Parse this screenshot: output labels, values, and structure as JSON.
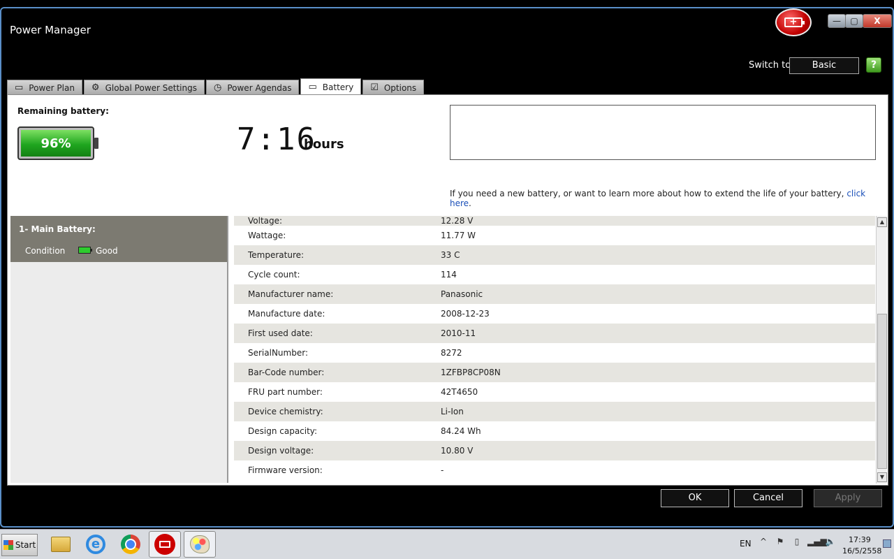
{
  "window": {
    "title": "Power Manager",
    "controls": {
      "minimize": "—",
      "maximize": "▢",
      "close": "X"
    }
  },
  "header": {
    "switch_label": "Switch to:",
    "switch_value": "Basic",
    "help_icon": "?"
  },
  "tabs": [
    {
      "label": "Power Plan",
      "icon": "laptop-icon",
      "glyph": "▭"
    },
    {
      "label": "Global Power Settings",
      "icon": "gear-icon",
      "glyph": "⚙"
    },
    {
      "label": "Power Agendas",
      "icon": "clock-icon",
      "glyph": "◷"
    },
    {
      "label": "Battery",
      "icon": "battery-icon",
      "glyph": "▭",
      "active": true
    },
    {
      "label": "Options",
      "icon": "checkbox-icon",
      "glyph": "☑"
    }
  ],
  "battery_summary": {
    "remaining_label": "Remaining battery:",
    "percent": "96%",
    "time": "7:16",
    "time_unit": "hours",
    "info_text": "If you need a new battery, or want to learn more about how to extend the life of your battery,",
    "info_link": "click here",
    "info_suffix": "."
  },
  "batteries": [
    {
      "name": "1- Main Battery:",
      "condition_label": "Condition",
      "condition_value": "Good",
      "condition_color": "#2ecc2e"
    }
  ],
  "details": [
    {
      "key": "Voltage:",
      "value": "12.28 V"
    },
    {
      "key": "Wattage:",
      "value": "11.77 W"
    },
    {
      "key": "Temperature:",
      "value": "33 C"
    },
    {
      "key": "Cycle count:",
      "value": "114"
    },
    {
      "key": "Manufacturer name:",
      "value": "Panasonic"
    },
    {
      "key": "Manufacture date:",
      "value": "2008-12-23"
    },
    {
      "key": "First used date:",
      "value": "2010-11"
    },
    {
      "key": "SerialNumber:",
      "value": "8272"
    },
    {
      "key": "Bar-Code number:",
      "value": "1ZFBP8CP08N"
    },
    {
      "key": "FRU part number:",
      "value": "42T4650"
    },
    {
      "key": "Device chemistry:",
      "value": "Li-Ion"
    },
    {
      "key": "Design capacity:",
      "value": "84.24 Wh"
    },
    {
      "key": "Design voltage:",
      "value": "10.80 V"
    },
    {
      "key": "Firmware version:",
      "value": "-"
    }
  ],
  "dialog_buttons": {
    "ok": "OK",
    "cancel": "Cancel",
    "apply": "Apply"
  },
  "taskbar": {
    "start": "Start",
    "apps": [
      "file-explorer-icon",
      "internet-explorer-icon",
      "chrome-icon",
      "power-manager-icon",
      "paint-icon"
    ],
    "ie_glyph": "e",
    "language": "EN",
    "tray_glyphs": [
      "^",
      "⚑",
      "▯",
      "▂▄▆",
      "🔈"
    ],
    "time": "17:39",
    "date": "16/5/2558"
  },
  "colors": {
    "accent_blue": "#1a4fb8",
    "battery_green": "#1fa51f",
    "panel_header": "#7c7a71"
  }
}
